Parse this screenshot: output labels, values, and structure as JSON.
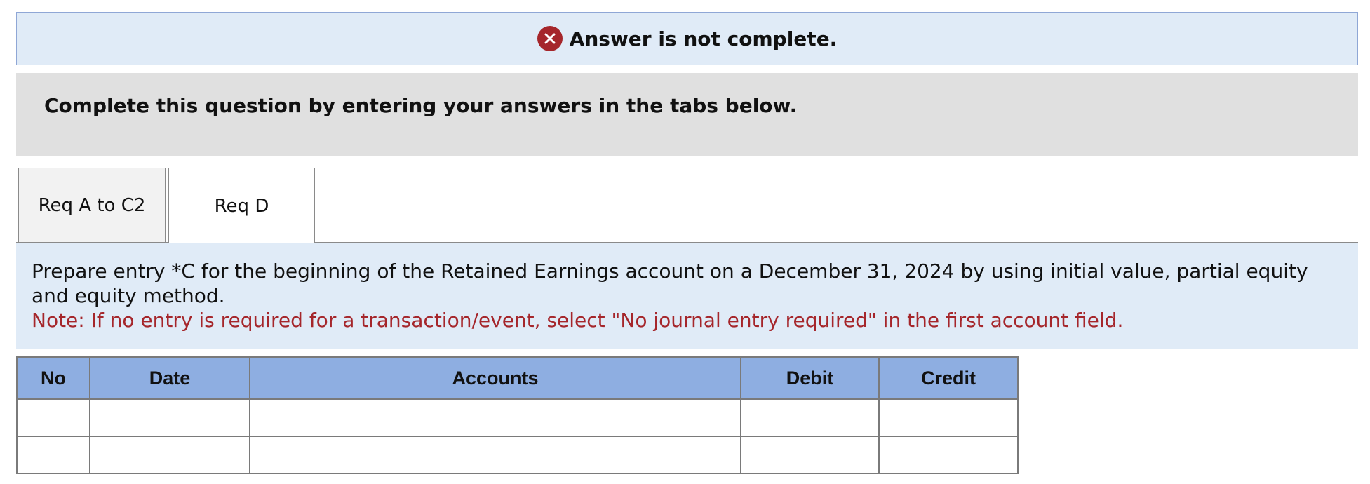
{
  "banner": {
    "icon": "close-circle-icon",
    "icon_color": "#a5262b",
    "text": "Answer is not complete."
  },
  "instructions": {
    "text": "Complete this question by entering your answers in the tabs below."
  },
  "tabs": [
    {
      "label": "Req A to C2",
      "active": false
    },
    {
      "label": "Req D",
      "active": true
    }
  ],
  "prompt": {
    "text": "Prepare entry *C for the beginning of the Retained Earnings account on a December 31, 2024 by using initial value, partial equity and equity method.",
    "note": "Note: If no entry is required for a transaction/event, select \"No journal entry required\" in the first account field."
  },
  "journal_table": {
    "headers": [
      "No",
      "Date",
      "Accounts",
      "Debit",
      "Credit"
    ],
    "rows": [
      [
        "",
        "",
        "",
        "",
        ""
      ],
      [
        "",
        "",
        "",
        "",
        ""
      ]
    ]
  },
  "colors": {
    "banner_bg": "#e0ebf7",
    "header_bg": "#8eaee1",
    "note_color": "#a5262b"
  }
}
